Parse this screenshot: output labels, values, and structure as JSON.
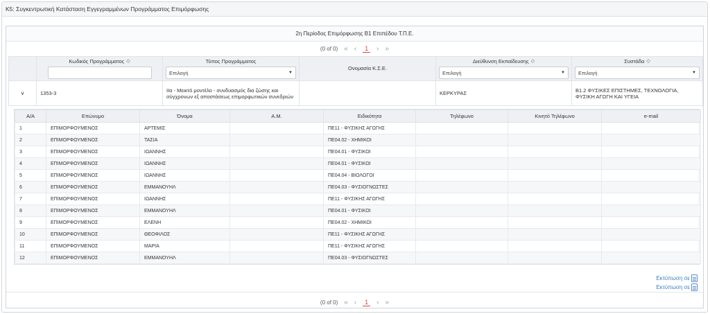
{
  "header": {
    "title": "Κ5: Συγκεντρωτική Κατάσταση Εγγεγραμμένων Προγράμματος Επιμόρφωσης"
  },
  "grid": {
    "caption": "2η Περίοδος Επιμόρφωσης Β1 Επιπέδου Τ.Π.Ε."
  },
  "pager": {
    "info": "(0 of 0)",
    "first": "«",
    "prev": "‹",
    "page": "1",
    "next": "›",
    "last": "»"
  },
  "columns": {
    "code": "Κωδικός Προγράμματος",
    "type": "Τύπος Προγράμματος",
    "kse": "Ονομασία Κ.Σ.Ε.",
    "directorate": "Διεύθυνση Εκπαίδευσης",
    "cluster": "Συστάδα"
  },
  "filters": {
    "code_value": "",
    "type_selected": "Επιλογή",
    "directorate_selected": "Επιλογή",
    "cluster_selected": "Επιλογή"
  },
  "row": {
    "code": "1353-3",
    "type": "ΙΙα - Μεικτό μοντέλο - συνδυασμός δια ζώσης και σύγχρονων εξ αποστάσεως επιμορφωτικών συνεδριών",
    "kse": "",
    "directorate": "ΚΕΡΚΥΡΑΣ",
    "cluster": "Β1.2 ΦΥΣΙΚΕΣ ΕΠΙΣΤΗΜΕΣ, ΤΕΧΝΟΛΟΓΙΑ, ΦΥΣΙΚΗ ΑΓΩΓΗ ΚΑΙ ΥΓΕΙΑ"
  },
  "detail": {
    "headers": [
      "Α/Α",
      "Επώνυμο",
      "Όνομα",
      "Α.Μ.",
      "Ειδικότητα",
      "Τηλέφωνο",
      "Κινητό Τηλέφωνο",
      "e-mail"
    ],
    "rows": [
      [
        "1",
        "ΕΠΙΜΟΡΦΟΥΜΕΝΟΣ",
        "ΑΡΤΕΜΙΣ",
        "",
        "ΠΕ11 - ΦΥΣΙΚΗΣ ΑΓΩΓΗΣ",
        "",
        "",
        ""
      ],
      [
        "2",
        "ΕΠΙΜΟΡΦΟΥΜΕΝΟΣ",
        "ΤΑΣΙΑ",
        "",
        "ΠΕ04.02 - ΧΗΜΙΚΟΙ",
        "",
        "",
        ""
      ],
      [
        "3",
        "ΕΠΙΜΟΡΦΟΥΜΕΝΟΣ",
        "ΙΩΑΝΝΗΣ",
        "",
        "ΠΕ04.01 - ΦΥΣΙΚΟΙ",
        "",
        "",
        ""
      ],
      [
        "4",
        "ΕΠΙΜΟΡΦΟΥΜΕΝΟΣ",
        "ΙΩΑΝΝΗΣ",
        "",
        "ΠΕ04.01 - ΦΥΣΙΚΟΙ",
        "",
        "",
        ""
      ],
      [
        "5",
        "ΕΠΙΜΟΡΦΟΥΜΕΝΟΣ",
        "ΙΩΑΝΝΗΣ",
        "",
        "ΠΕ04.04 - ΒΙΟΛΟΓΟΙ",
        "",
        "",
        ""
      ],
      [
        "6",
        "ΕΠΙΜΟΡΦΟΥΜΕΝΟΣ",
        "ΕΜΜΑΝΟΥΗΛ",
        "",
        "ΠΕ04.03 - ΦΥΣΙΟΓΝΩΣΤΕΣ",
        "",
        "",
        ""
      ],
      [
        "7",
        "ΕΠΙΜΟΡΦΟΥΜΕΝΟΣ",
        "ΙΩΑΝΝΗΣ",
        "",
        "ΠΕ11 - ΦΥΣΙΚΗΣ ΑΓΩΓΗΣ",
        "",
        "",
        ""
      ],
      [
        "8",
        "ΕΠΙΜΟΡΦΟΥΜΕΝΟΣ",
        "ΕΜΜΑΝΟΥΗΛ",
        "",
        "ΠΕ04.01 - ΦΥΣΙΚΟΙ",
        "",
        "",
        ""
      ],
      [
        "9",
        "ΕΠΙΜΟΡΦΟΥΜΕΝΟΣ",
        "ΕΛΕΝΗ",
        "",
        "ΠΕ04.02 - ΧΗΜΙΚΟΙ",
        "",
        "",
        ""
      ],
      [
        "10",
        "ΕΠΙΜΟΡΦΟΥΜΕΝΟΣ",
        "ΘΕΟΦΙΛΟΣ",
        "",
        "ΠΕ11 - ΦΥΣΙΚΗΣ ΑΓΩΓΗΣ",
        "",
        "",
        ""
      ],
      [
        "11",
        "ΕΠΙΜΟΡΦΟΥΜΕΝΟΣ",
        "ΜΑΡΙΑ",
        "",
        "ΠΕ11 - ΦΥΣΙΚΗΣ ΑΓΩΓΗΣ",
        "",
        "",
        ""
      ],
      [
        "12",
        "ΕΠΙΜΟΡΦΟΥΜΕΝΟΣ",
        "ΕΜΜΑΝΟΥΗΛ",
        "",
        "ΠΕ04.03 - ΦΥΣΙΟΓΝΩΣΤΕΣ",
        "",
        "",
        ""
      ]
    ]
  },
  "print": {
    "excel_label": "Εκτύπωση σε",
    "excel_icon": "excel-file-icon",
    "pdf_label": "Εκτύπωση σε",
    "pdf_icon": "pdf-file-icon"
  },
  "icons": {
    "sort": "sort-icon",
    "caret": "chevron-down-icon",
    "expander": "row-expander-icon"
  },
  "colors": {
    "link": "#3a7ec1",
    "active_page": "#e0403a",
    "header_bg": "#eef0f3"
  }
}
